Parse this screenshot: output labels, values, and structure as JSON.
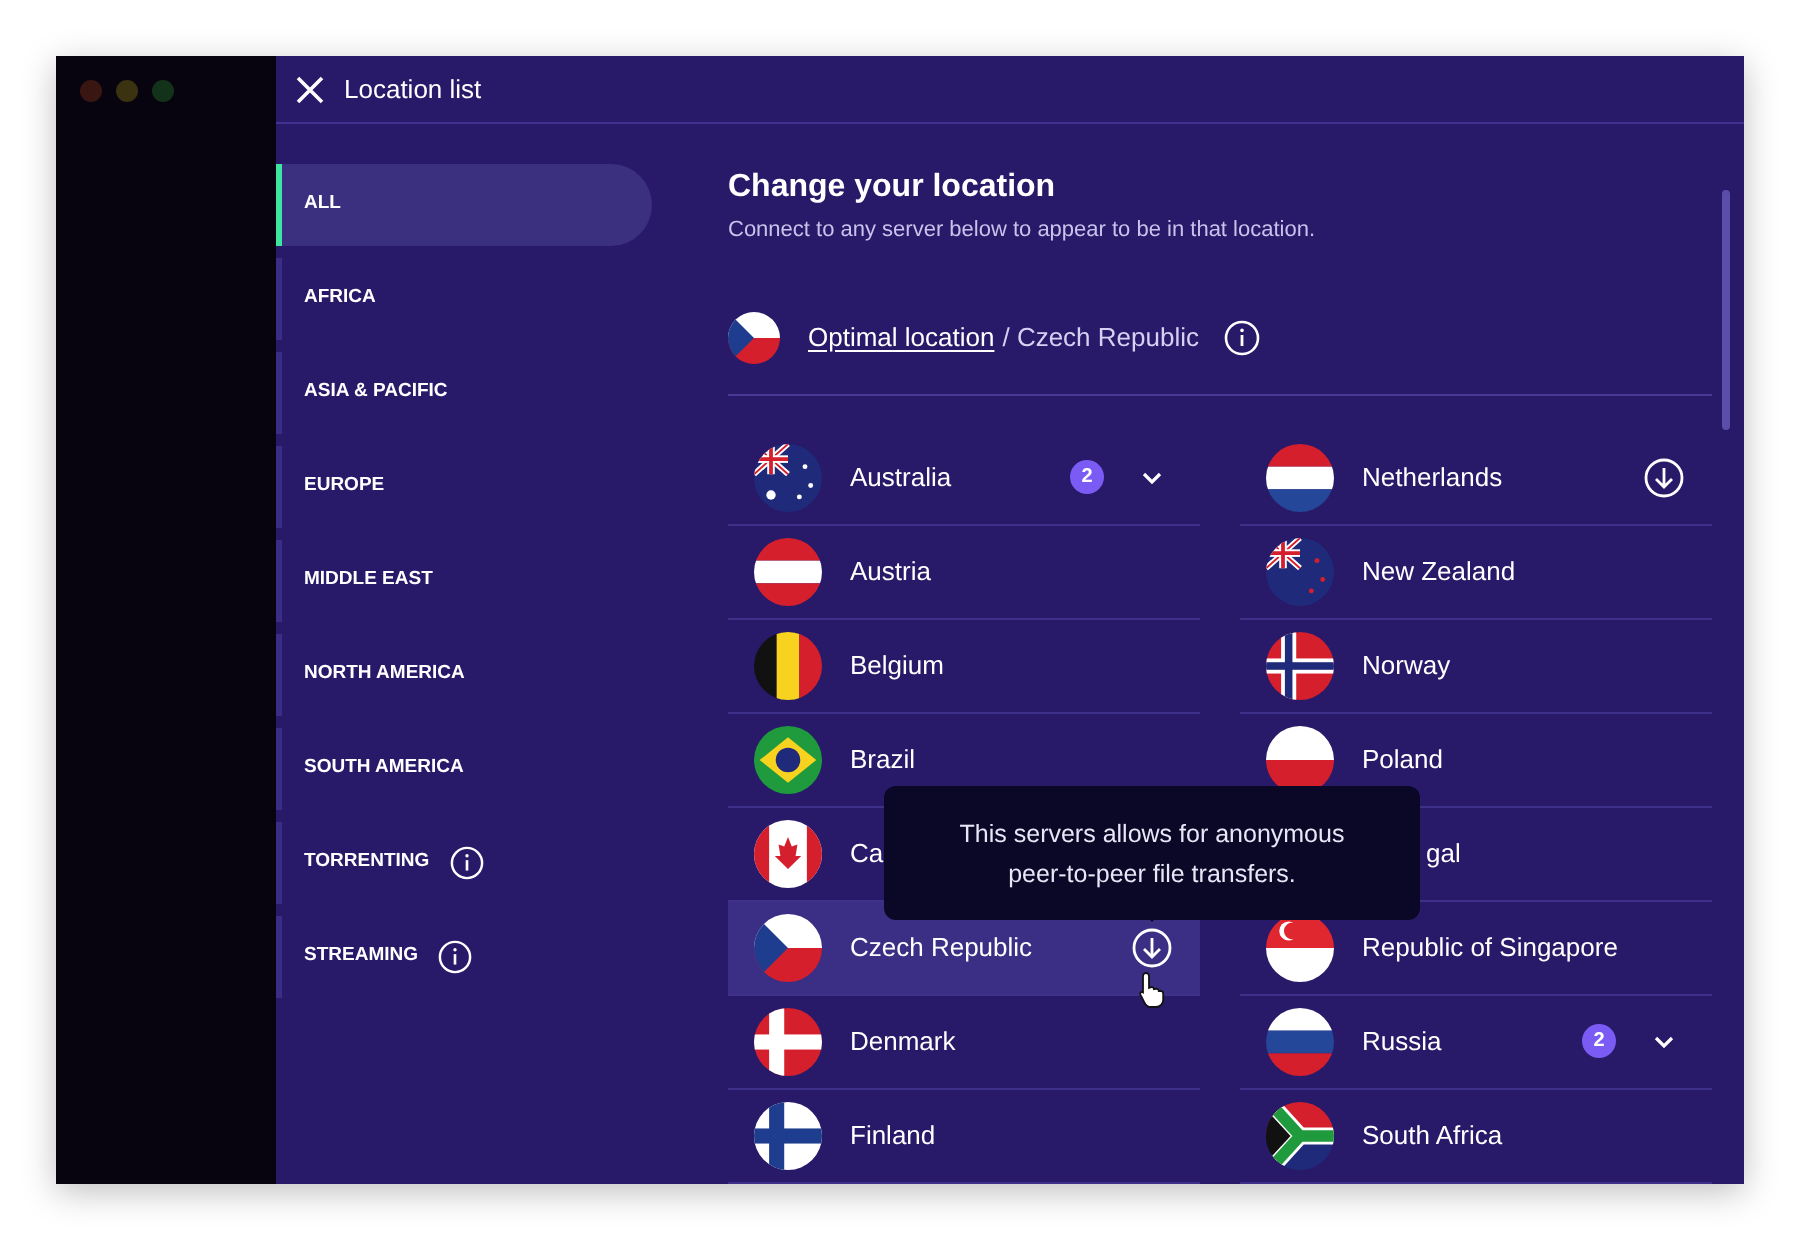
{
  "window": {
    "title": "Location list"
  },
  "sidebar": {
    "items": [
      {
        "label": "ALL",
        "selected": true,
        "info": false
      },
      {
        "label": "AFRICA",
        "selected": false,
        "info": false
      },
      {
        "label": "ASIA & PACIFIC",
        "selected": false,
        "info": false
      },
      {
        "label": "EUROPE",
        "selected": false,
        "info": false
      },
      {
        "label": "MIDDLE EAST",
        "selected": false,
        "info": false
      },
      {
        "label": "NORTH AMERICA",
        "selected": false,
        "info": false
      },
      {
        "label": "SOUTH AMERICA",
        "selected": false,
        "info": false
      },
      {
        "label": "TORRENTING",
        "selected": false,
        "info": true
      },
      {
        "label": "STREAMING",
        "selected": false,
        "info": true
      }
    ]
  },
  "content": {
    "title": "Change your location",
    "subtitle": "Connect to any server below to appear to be in that location.",
    "optimal": {
      "link": "Optimal location",
      "location": "/ Czech Republic",
      "kind": "cz"
    },
    "columns": [
      [
        {
          "name": "Australia",
          "kind": "au",
          "badge": "2",
          "expandable": true,
          "p2p": false,
          "hovered": false
        },
        {
          "name": "Austria",
          "kind": "at",
          "expandable": false,
          "p2p": false,
          "hovered": false
        },
        {
          "name": "Belgium",
          "kind": "be",
          "expandable": false,
          "p2p": false,
          "hovered": false
        },
        {
          "name": "Brazil",
          "kind": "br",
          "expandable": false,
          "p2p": false,
          "hovered": false
        },
        {
          "name": "Ca",
          "kind": "ca",
          "expandable": false,
          "p2p": false,
          "hovered": false
        },
        {
          "name": "Czech Republic",
          "kind": "cz",
          "expandable": false,
          "p2p": true,
          "hovered": true
        },
        {
          "name": "Denmark",
          "kind": "dk",
          "expandable": false,
          "p2p": false,
          "hovered": false
        },
        {
          "name": "Finland",
          "kind": "fi",
          "expandable": false,
          "p2p": false,
          "hovered": false
        }
      ],
      [
        {
          "name": "Netherlands",
          "kind": "nl",
          "expandable": false,
          "p2p": true,
          "hovered": false
        },
        {
          "name": "New Zealand",
          "kind": "nz",
          "expandable": false,
          "p2p": false,
          "hovered": false
        },
        {
          "name": "Norway",
          "kind": "no",
          "expandable": false,
          "p2p": false,
          "hovered": false
        },
        {
          "name": "Poland",
          "kind": "pl",
          "expandable": false,
          "p2p": false,
          "hovered": false
        },
        {
          "name": "gal",
          "expandable": false,
          "p2p": false,
          "hovered": false
        },
        {
          "name": "Republic of Singapore",
          "kind": "sg",
          "expandable": false,
          "p2p": false,
          "hovered": false
        },
        {
          "name": "Russia",
          "kind": "ru",
          "badge": "2",
          "expandable": true,
          "p2p": false,
          "hovered": false
        },
        {
          "name": "South Africa",
          "kind": "za",
          "expandable": false,
          "p2p": false,
          "hovered": false
        }
      ]
    ],
    "tooltip": "This servers allows for anonymous peer-to-peer file transfers."
  }
}
